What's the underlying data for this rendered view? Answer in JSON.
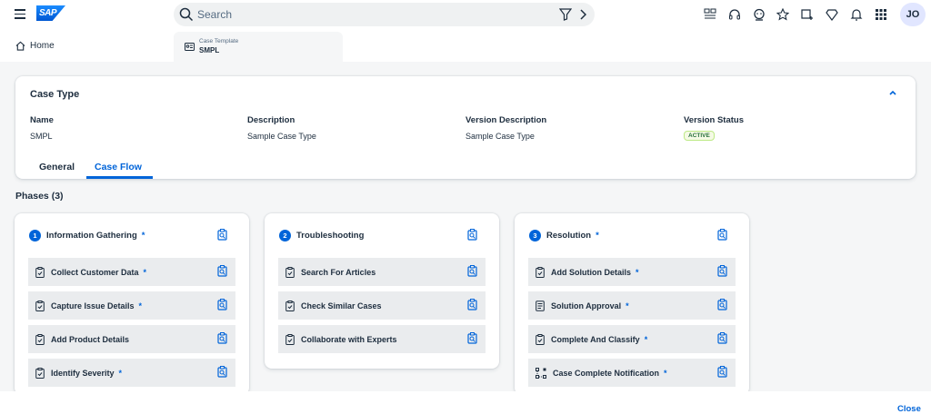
{
  "shell": {
    "logo": "SAP",
    "search_placeholder": "Search",
    "avatar": "JO",
    "icons": [
      "user-switch-icon",
      "headset-icon",
      "chat-bot-icon",
      "favorite-icon",
      "add-tile-icon",
      "diamond-icon",
      "bell-icon",
      "apps-grid-icon"
    ]
  },
  "nav": {
    "home": "Home",
    "app_tab_label": "Case Template",
    "app_tab_value": "SMPL"
  },
  "case_type": {
    "title": "Case Type",
    "fields": [
      {
        "label": "Name",
        "value": "SMPL"
      },
      {
        "label": "Description",
        "value": "Sample Case Type"
      },
      {
        "label": "Version Description",
        "value": "Sample Case Type"
      },
      {
        "label": "Version Status",
        "value": "ACTIVE"
      }
    ],
    "tabs": [
      "General",
      "Case Flow"
    ],
    "selected_tab": "Case Flow"
  },
  "phases_title": "Phases (3)",
  "phases": [
    {
      "number": "1",
      "name": "Information Gathering",
      "required": "*",
      "steps": [
        {
          "label": "Collect Customer Data",
          "required": "*"
        },
        {
          "label": "Capture Issue Details",
          "required": "*"
        },
        {
          "label": "Add Product Details",
          "required": ""
        },
        {
          "label": "Identify Severity",
          "required": "*"
        }
      ]
    },
    {
      "number": "2",
      "name": "Troubleshooting",
      "required": "",
      "steps": [
        {
          "label": "Search For Articles",
          "required": ""
        },
        {
          "label": "Check Similar Cases",
          "required": ""
        },
        {
          "label": "Collaborate with Experts",
          "required": ""
        }
      ]
    },
    {
      "number": "3",
      "name": "Resolution",
      "required": "*",
      "steps": [
        {
          "label": "Add Solution Details",
          "required": "*"
        },
        {
          "label": "Solution Approval",
          "required": "*"
        },
        {
          "label": "Complete And Classify",
          "required": "*"
        },
        {
          "label": "Case Complete Notification",
          "required": "*"
        }
      ]
    }
  ],
  "footer": {
    "close": "Close"
  },
  "colors": {
    "accent": "#0064d9",
    "success_text": "#256f3a",
    "step_bg": "#eaecee"
  }
}
